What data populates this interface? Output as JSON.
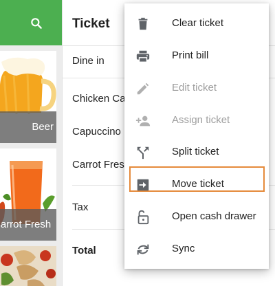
{
  "products": [
    {
      "name": "Beer"
    },
    {
      "name": "Carrot Fresh"
    }
  ],
  "ticket": {
    "title": "Ticket",
    "order_type": "Dine in",
    "items": [
      "Chicken Caesar",
      "Capuccino",
      "Carrot Fresh"
    ],
    "tax_label": "Tax",
    "total_label": "Total"
  },
  "menu": {
    "items": [
      {
        "label": "Clear ticket",
        "icon": "trash-icon",
        "enabled": true
      },
      {
        "label": "Print bill",
        "icon": "printer-icon",
        "enabled": true
      },
      {
        "label": "Edit ticket",
        "icon": "pencil-icon",
        "enabled": false
      },
      {
        "label": "Assign ticket",
        "icon": "person-add-icon",
        "enabled": false
      },
      {
        "label": "Split ticket",
        "icon": "split-icon",
        "enabled": true
      },
      {
        "label": "Move ticket",
        "icon": "move-icon",
        "enabled": true,
        "highlighted": true
      },
      {
        "label": "Open cash drawer",
        "icon": "unlock-icon",
        "enabled": true
      },
      {
        "label": "Sync",
        "icon": "sync-icon",
        "enabled": true
      }
    ]
  },
  "colors": {
    "brand_green": "#4CAF50",
    "highlight_orange": "#E58A3A",
    "icon_dark": "#5f6368",
    "icon_disabled": "#b0b0b0"
  }
}
